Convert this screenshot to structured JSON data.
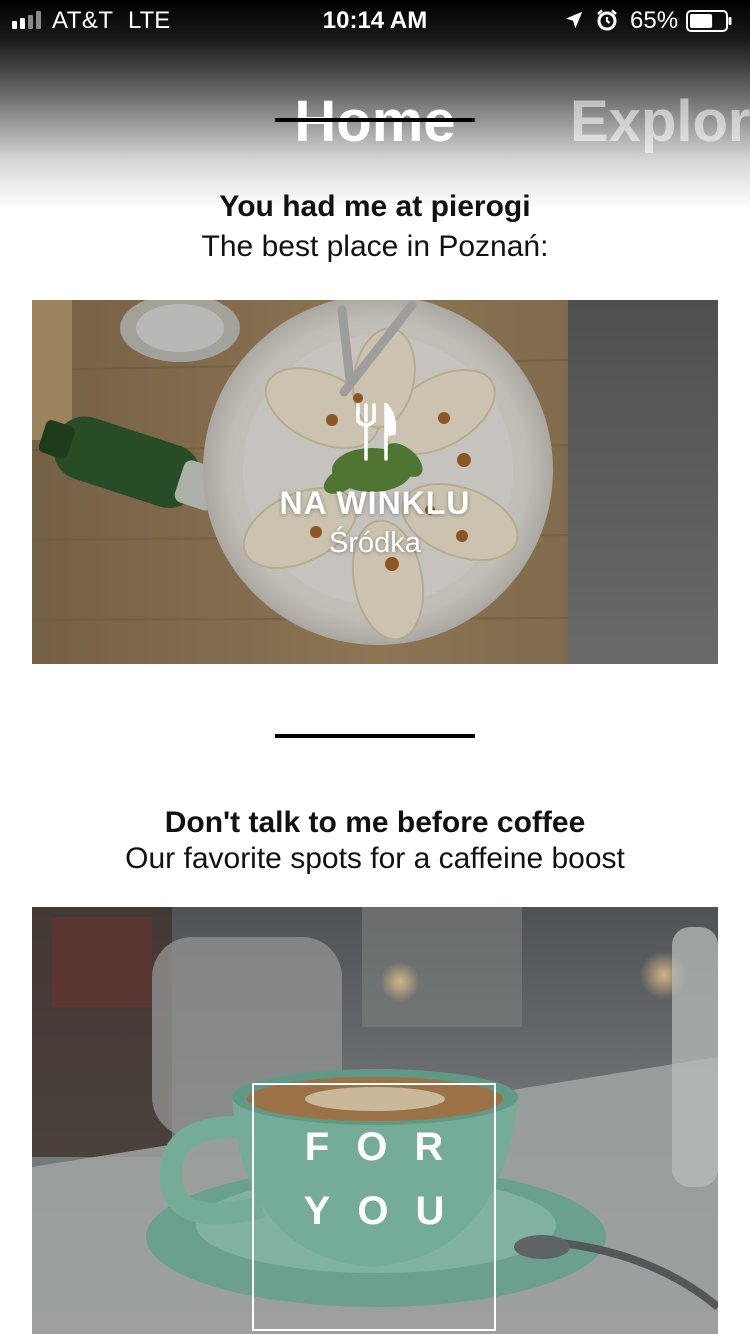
{
  "status_bar": {
    "carrier": "AT&T",
    "network": "LTE",
    "time": "10:14 AM",
    "battery": "65%",
    "battery_level": 0.65,
    "signal_bars": 2,
    "icons": [
      "location-arrow-icon",
      "alarm-clock-icon",
      "battery-icon"
    ]
  },
  "tabs": [
    {
      "label": "Home",
      "active": true
    },
    {
      "label": "Explore",
      "active": false
    }
  ],
  "sections": [
    {
      "title": "You had me at pierogi",
      "subtitle": "The best place in Poznań:",
      "card": {
        "icon": "fork-knife-icon",
        "name": "NA WINKLU",
        "area": "Śródka"
      }
    },
    {
      "title": "Don't talk to me before coffee",
      "subtitle": "Our favorite spots for a caffeine boost",
      "card": {
        "badge_line1": "FOR",
        "badge_line2": "YOU"
      }
    }
  ],
  "colors": {
    "header_top": "#000000",
    "accent": "#000000",
    "overlay_text": "#ffffff"
  }
}
